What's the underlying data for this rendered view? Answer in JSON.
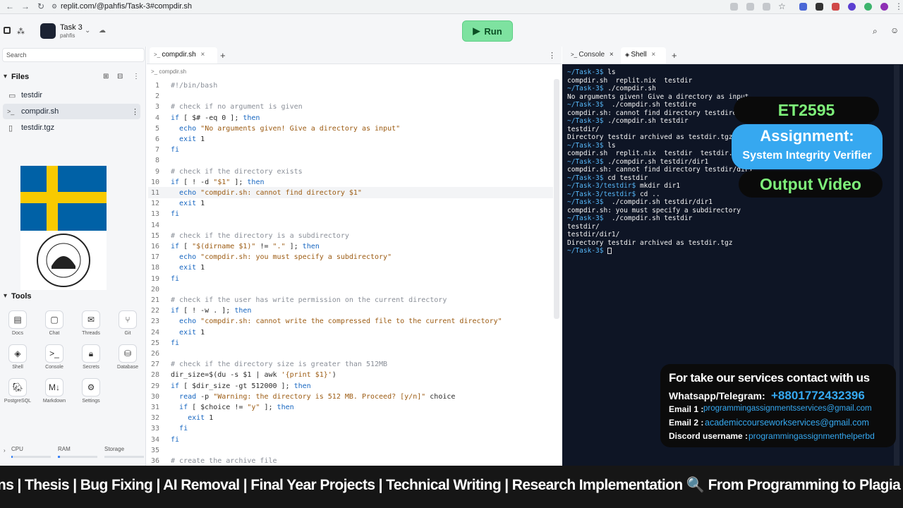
{
  "browser": {
    "url": "replit.com/@pahfis/Task-3#compdir.sh"
  },
  "project": {
    "name": "Task 3",
    "owner": "pahfis"
  },
  "run_label": "Run",
  "sidebar": {
    "search_placeholder": "Search",
    "files_title": "Files",
    "files": [
      "testdir",
      "compdir.sh",
      "testdir.tgz"
    ],
    "tools_title": "Tools",
    "tools": [
      "Docs",
      "Chat",
      "Threads",
      "Git",
      "Shell",
      "Console",
      "Secrets",
      "Database",
      "PostgreSQL",
      "Markdown",
      "Settings"
    ],
    "resources": [
      "CPU",
      "RAM",
      "Storage"
    ]
  },
  "editor": {
    "tab": "compdir.sh",
    "breadcrumb": "compdir.sh",
    "lines": [
      "#!/bin/bash",
      "",
      "# check if no argument is given",
      "if [ $# -eq 0 ]; then",
      "  echo \"No arguments given! Give a directory as input\"",
      "  exit 1",
      "fi",
      "",
      "# check if the directory exists",
      "if [ ! -d \"$1\" ]; then",
      "  echo \"compdir.sh: cannot find directory $1\"",
      "  exit 1",
      "fi",
      "",
      "# check if the directory is a subdirectory",
      "if [ \"$(dirname $1)\" != \".\" ]; then",
      "  echo \"compdir.sh: you must specify a subdirectory\"",
      "  exit 1",
      "fi",
      "",
      "# check if the user has write permission on the current directory",
      "if [ ! -w . ]; then",
      "  echo \"compdir.sh: cannot write the compressed file to the current directory\"",
      "  exit 1",
      "fi",
      "",
      "# check if the directory size is greater than 512MB",
      "dir_size=$(du -s $1 | awk '{print $1}')",
      "if [ $dir_size -gt 512000 ]; then",
      "  read -p \"Warning: the directory is 512 MB. Proceed? [y/n]\" choice",
      "  if [ $choice != \"y\" ]; then",
      "    exit 1",
      "  fi",
      "fi",
      "",
      "# create the archive file"
    ]
  },
  "console": {
    "tabs": [
      "Console",
      "Shell"
    ],
    "lines": [
      [
        "~/Task-3$ ",
        "ls"
      ],
      [
        "",
        "compdir.sh  replit.nix  testdir"
      ],
      [
        "~/Task-3$ ",
        "./compdir.sh"
      ],
      [
        "",
        "No arguments given! Give a directory as input"
      ],
      [
        "~/Task-3$ ",
        " ./compdir.sh testdire"
      ],
      [
        "",
        "compdir.sh: cannot find directory testdire"
      ],
      [
        "~/Task-3$ ",
        "./compdir.sh testdir"
      ],
      [
        "",
        "testdir/"
      ],
      [
        "",
        "Directory testdir archived as testdir.tgz"
      ],
      [
        "~/Task-3$ ",
        "ls"
      ],
      [
        "",
        "compdir.sh  replit.nix  testdir  testdir.tgz"
      ],
      [
        "~/Task-3$ ",
        "./compdir.sh testdir/dir1"
      ],
      [
        "",
        "compdir.sh: cannot find directory testdir/dir1"
      ],
      [
        "~/Task-3$ ",
        "cd testdir"
      ],
      [
        "~/Task-3/testdir$ ",
        "mkdir dir1"
      ],
      [
        "~/Task-3/testdir$ ",
        "cd .."
      ],
      [
        "~/Task-3$ ",
        " ./compdir.sh testdir/dir1"
      ],
      [
        "",
        "compdir.sh: you must specify a subdirectory"
      ],
      [
        "~/Task-3$ ",
        " ./compdir.sh testdir"
      ],
      [
        "",
        "testdir/"
      ],
      [
        "",
        "testdir/dir1/"
      ],
      [
        "",
        "Directory testdir archived as testdir.tgz"
      ],
      [
        "~/Task-3$ ",
        ""
      ]
    ]
  },
  "overlay": {
    "code": "ET2595",
    "assignment": "Assignment:",
    "subject": "System Integrity Verifier",
    "output": "Output Video",
    "contact_title": "For take our services contact with us",
    "whatsapp_label": "Whatsapp/Telegram:",
    "whatsapp": "+8801772432396",
    "email1_label": "Email 1 :",
    "email1": "programmingassignmentsservices@gmail.com",
    "email2_label": "Email 2 :",
    "email2": "academiccourseworkservices@gmail.com",
    "discord_label": "Discord username :",
    "discord": "programmingassignmenthelperbd",
    "ticker": "ns | Thesis | Bug Fixing | AI Removal | Final Year Projects | Technical Writing | Research Implementation 🔍 From Programming to Plagia"
  }
}
